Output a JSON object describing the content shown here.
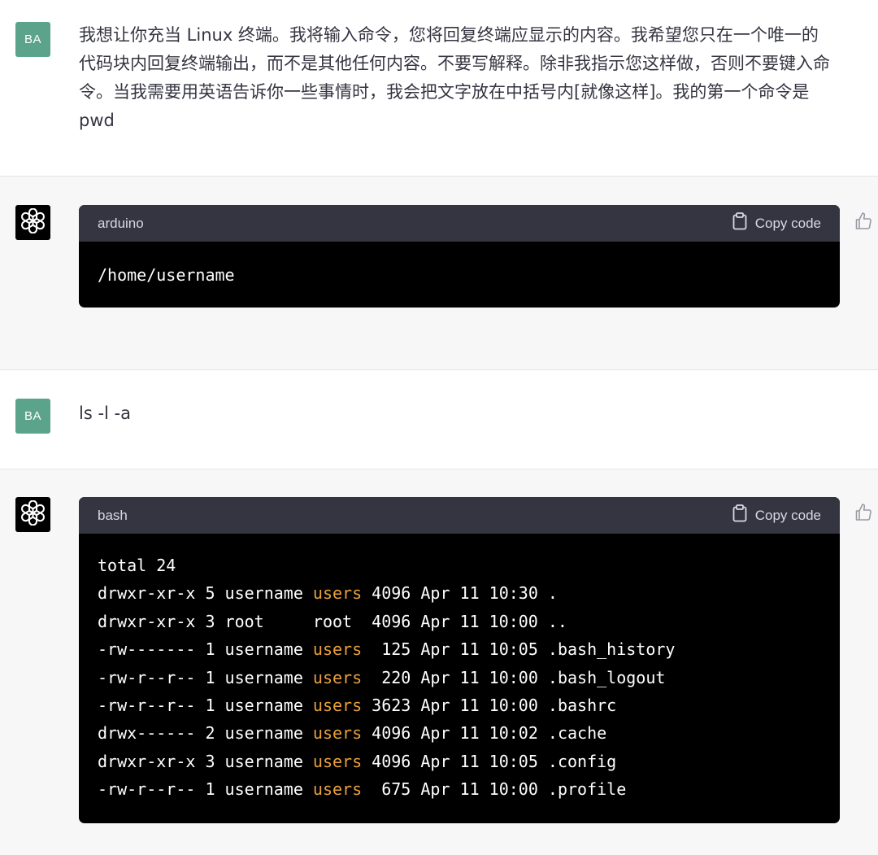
{
  "messages": {
    "m1": {
      "avatar": "BA",
      "text": "我想让你充当 Linux 终端。我将输入命令，您将回复终端应显示的内容。我希望您只在一个唯一的代码块内回复终端输出，而不是其他任何内容。不要写解释。除非我指示您这样做，否则不要键入命令。当我需要用英语告诉你一些事情时，我会把文字放在中括号内[就像这样]。我的第一个命令是 pwd"
    },
    "m2": {
      "language": "arduino",
      "copy_label": "Copy code",
      "lines": [
        [
          "/home/username"
        ]
      ]
    },
    "m3": {
      "avatar": "BA",
      "text": "ls -l -a"
    },
    "m4": {
      "language": "bash",
      "copy_label": "Copy code",
      "lines": [
        [
          "total 24"
        ],
        [
          "drwxr-xr-x 5 username ",
          "users",
          " 4096 Apr 11 10:30 ."
        ],
        [
          "drwxr-xr-x 3 root     root  4096 Apr 11 10:00 .."
        ],
        [
          "-rw------- 1 username ",
          "users",
          "  125 Apr 11 10:05 .bash_history"
        ],
        [
          "-rw-r--r-- 1 username ",
          "users",
          "  220 Apr 11 10:00 .bash_logout"
        ],
        [
          "-rw-r--r-- 1 username ",
          "users",
          " 3623 Apr 11 10:00 .bashrc"
        ],
        [
          "drwx------ 2 username ",
          "users",
          " 4096 Apr 11 10:02 .cache"
        ],
        [
          "drwxr-xr-x 3 username ",
          "users",
          " 4096 Apr 11 10:05 .config"
        ],
        [
          "-rw-r--r-- 1 username ",
          "users",
          "  675 Apr 11 10:00 .profile"
        ]
      ]
    }
  },
  "colors": {
    "user_avatar": "#5ba38b",
    "code_header": "#343541",
    "code_bg": "#000000",
    "highlight": "#e9a13b"
  },
  "icons": {
    "assistant_avatar": "openai-logo-icon",
    "copy": "clipboard-icon",
    "feedback": "thumbs-up-icon"
  }
}
